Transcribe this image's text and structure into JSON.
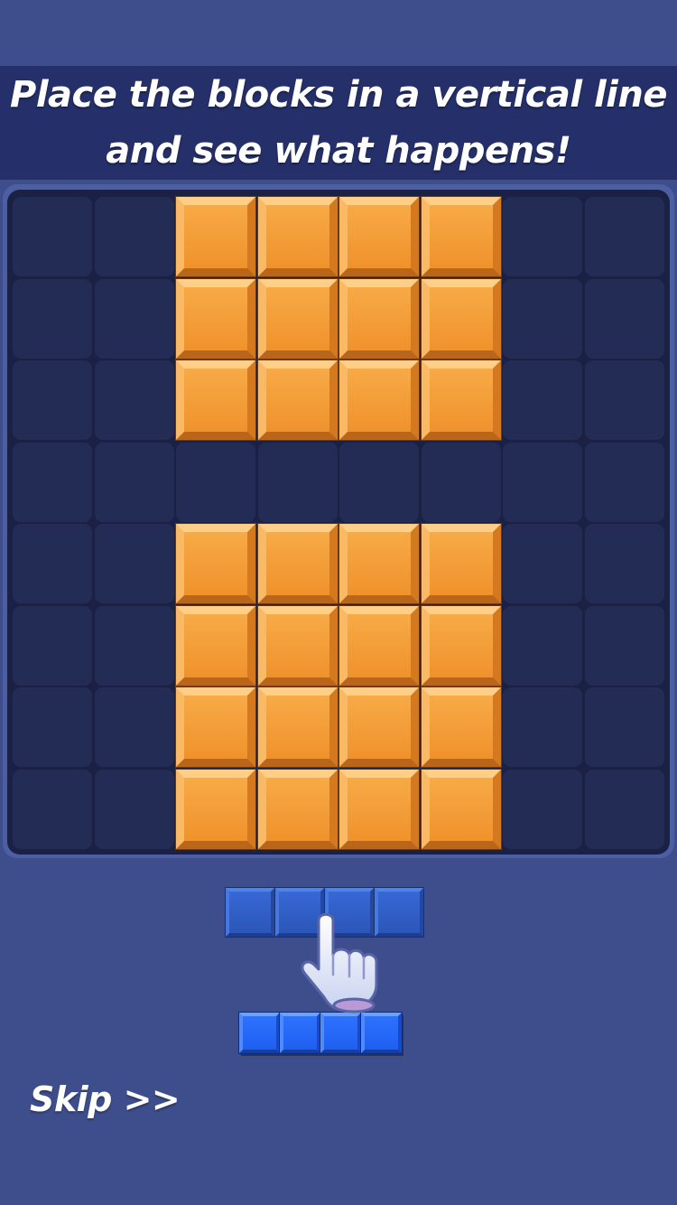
{
  "tutorial": {
    "line1": "Place the blocks in a vertical line",
    "line2": "and see what happens!"
  },
  "board": {
    "rows": 8,
    "cols": 8,
    "filled_color": "#f0922c",
    "empty_color": "#232c55",
    "grid": [
      [
        0,
        0,
        1,
        1,
        1,
        1,
        0,
        0
      ],
      [
        0,
        0,
        1,
        1,
        1,
        1,
        0,
        0
      ],
      [
        0,
        0,
        1,
        1,
        1,
        1,
        0,
        0
      ],
      [
        0,
        0,
        0,
        0,
        0,
        0,
        0,
        0
      ],
      [
        0,
        0,
        1,
        1,
        1,
        1,
        0,
        0
      ],
      [
        0,
        0,
        1,
        1,
        1,
        1,
        0,
        0
      ],
      [
        0,
        0,
        1,
        1,
        1,
        1,
        0,
        0
      ],
      [
        0,
        0,
        1,
        1,
        1,
        1,
        0,
        0
      ]
    ]
  },
  "pieces": {
    "ghost": {
      "blocks": 4,
      "color": "#2c56b8",
      "orientation": "horizontal"
    },
    "tray": {
      "blocks": 4,
      "color": "#1f5ff0",
      "orientation": "horizontal"
    }
  },
  "hand_icon": "pointing-hand-icon",
  "skip_label": "Skip >>"
}
